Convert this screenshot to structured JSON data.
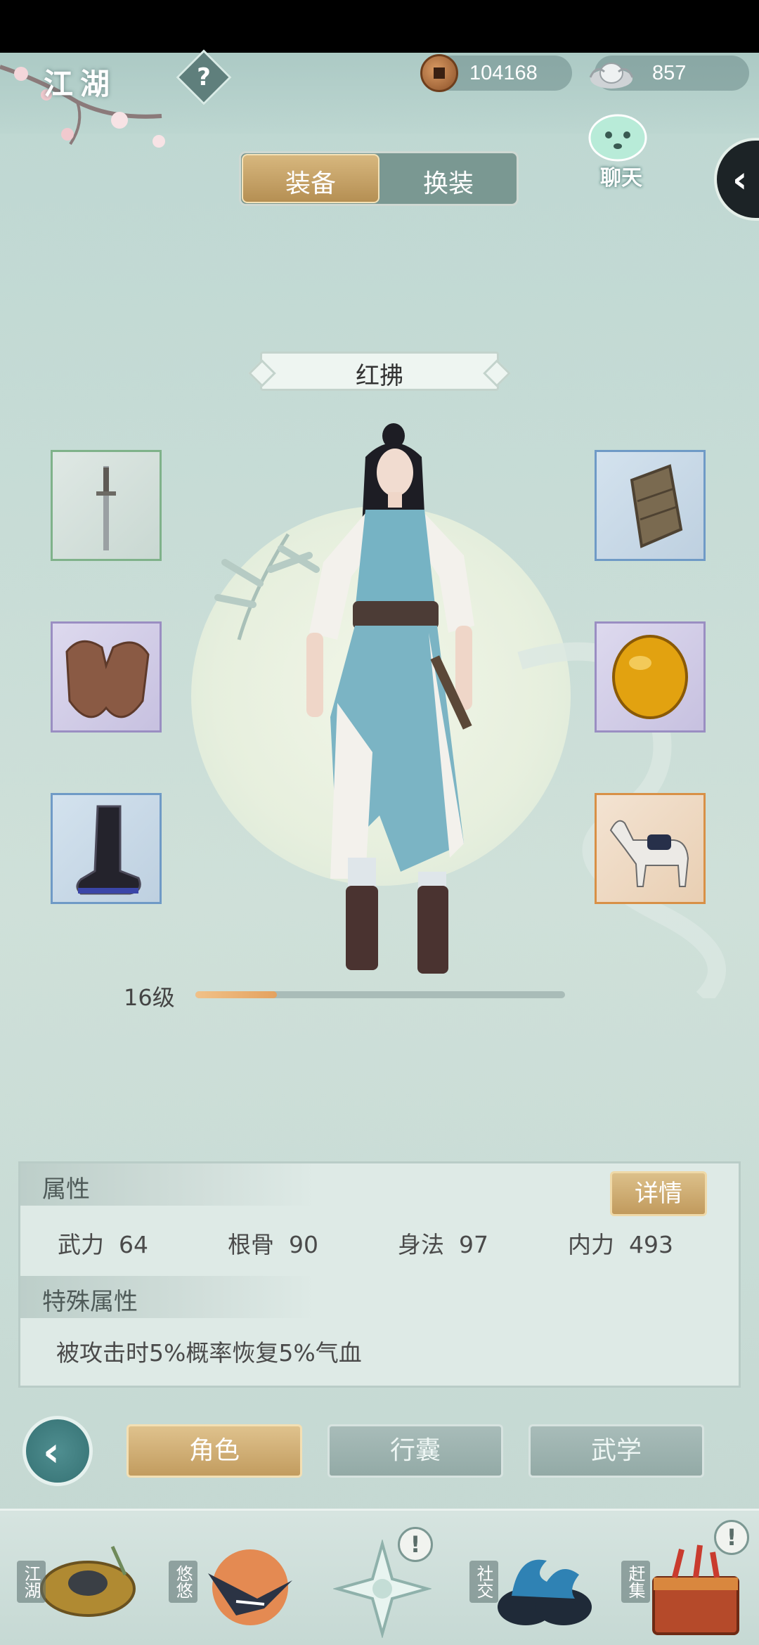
{
  "header": {
    "title": "江湖",
    "help_icon": "?",
    "copper": "104168",
    "silver": "857"
  },
  "chat": {
    "label": "聊天"
  },
  "side_toggle": "‹",
  "tabs": [
    {
      "label": "装备",
      "active": true
    },
    {
      "label": "换装",
      "active": false
    }
  ],
  "character": {
    "name": "红拂",
    "level_text": "16级",
    "level_progress": 0.22
  },
  "slots": {
    "left": [
      {
        "name": "weapon-sword",
        "quality": "green"
      },
      {
        "name": "armor-leather",
        "quality": "purple"
      },
      {
        "name": "boots",
        "quality": "blue"
      }
    ],
    "right": [
      {
        "name": "bracer",
        "quality": "blue"
      },
      {
        "name": "amber-orb",
        "quality": "purple"
      },
      {
        "name": "horse-mount",
        "quality": "orange"
      }
    ]
  },
  "attributes": {
    "title": "属性",
    "detail_button": "详情",
    "items": [
      {
        "label": "武力",
        "value": "64"
      },
      {
        "label": "根骨",
        "value": "90"
      },
      {
        "label": "身法",
        "value": "97"
      },
      {
        "label": "内力",
        "value": "493"
      }
    ],
    "special_title": "特殊属性",
    "special_text": "被攻击时5%概率恢复5%气血"
  },
  "bottom_tabs": [
    {
      "label": "角色",
      "active": true
    },
    {
      "label": "行囊",
      "active": false
    },
    {
      "label": "武学",
      "active": false
    }
  ],
  "back_icon": "‹",
  "nav": [
    {
      "label": "江湖",
      "alert": false
    },
    {
      "label": "悠悠",
      "alert": false
    },
    {
      "label": "",
      "alert": true
    },
    {
      "label": "社交",
      "alert": false
    },
    {
      "label": "赶集",
      "alert": true
    }
  ],
  "nav_alert": "!",
  "colors": {
    "gold": "#c19a5d",
    "teal": "#3d7a7c",
    "accent_orange": "#e4a25f"
  }
}
